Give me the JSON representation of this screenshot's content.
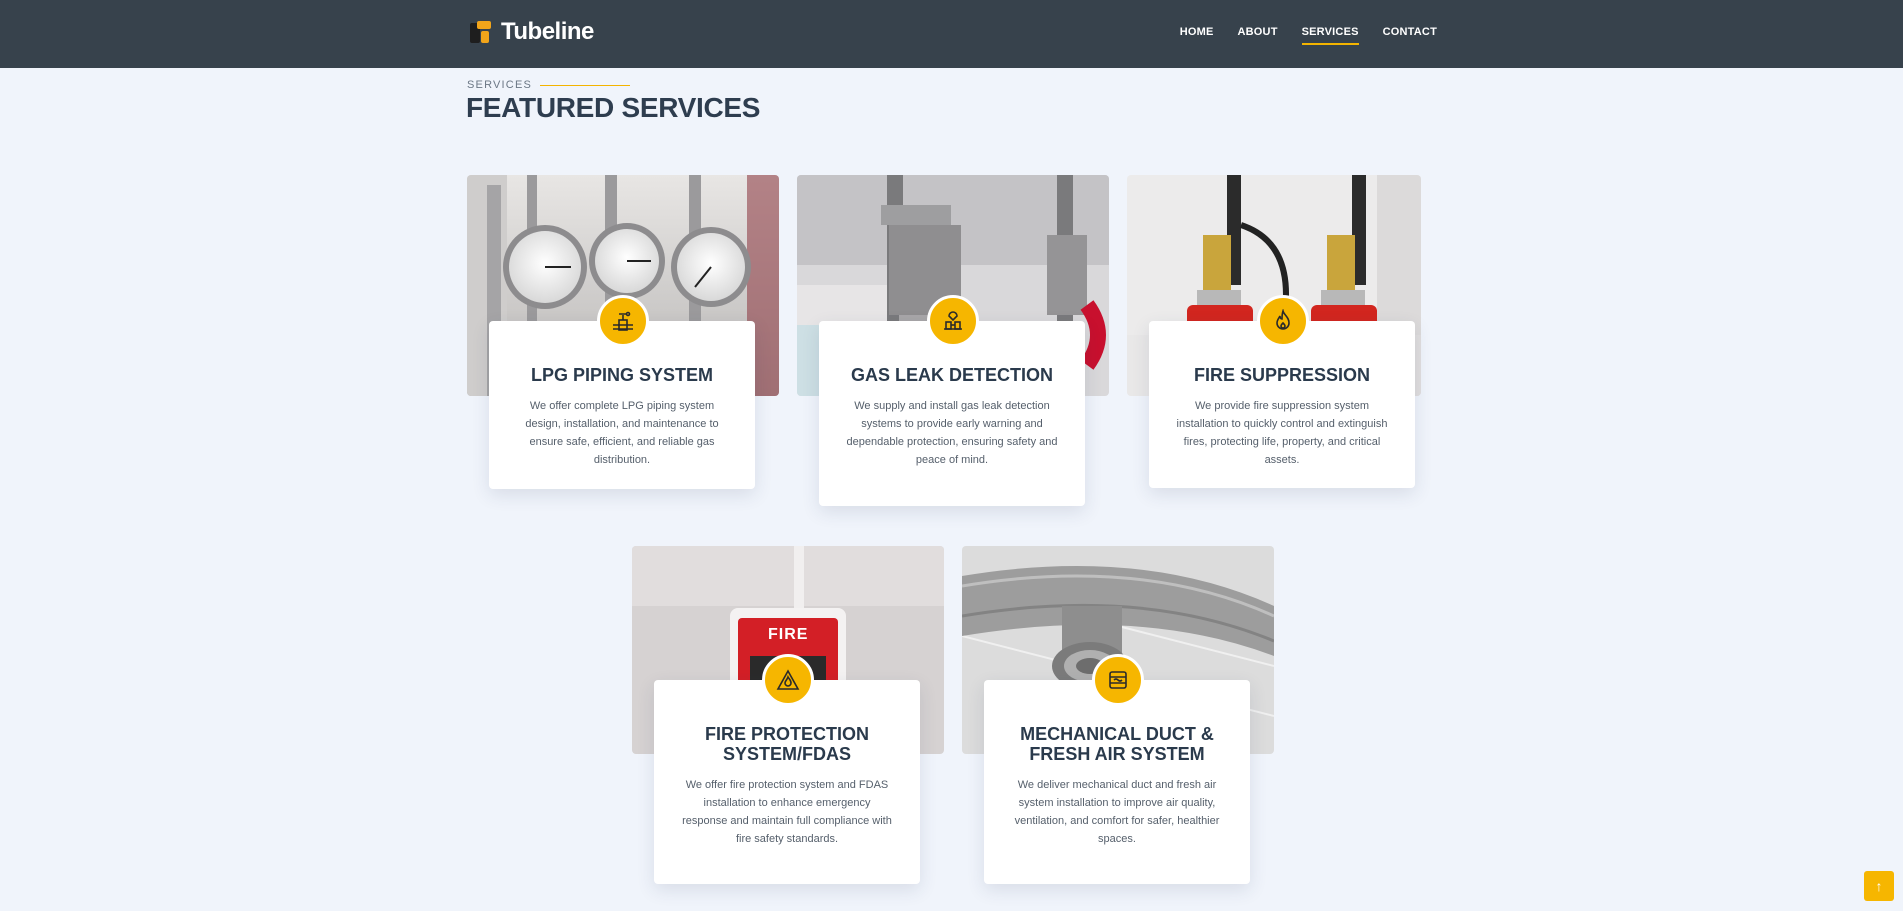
{
  "header": {
    "brand": "Tubeline",
    "nav": [
      {
        "label": "HOME",
        "active": false
      },
      {
        "label": "ABOUT",
        "active": false
      },
      {
        "label": "SERVICES",
        "active": true
      },
      {
        "label": "CONTACT",
        "active": false
      }
    ]
  },
  "section": {
    "eyebrow": "SERVICES",
    "title": "FEATURED SERVICES"
  },
  "services": [
    {
      "title": "LPG PIPING SYSTEM",
      "description": "We offer complete LPG piping system design, installation, and maintenance to ensure safe, efficient, and reliable gas distribution.",
      "icon": "pipe-valve-icon",
      "photo": "pressure-gauges-photo"
    },
    {
      "title": "GAS LEAK DETECTION",
      "description": "We supply and install gas leak detection systems to provide early warning and dependable protection, ensuring safety and peace of mind.",
      "icon": "leak-detector-icon",
      "photo": "gas-valves-photo"
    },
    {
      "title": "FIRE SUPPRESSION",
      "description": "We provide fire suppression system installation to quickly control and extinguish fires, protecting life, property, and critical assets.",
      "icon": "flame-icon",
      "photo": "suppression-cylinders-photo"
    },
    {
      "title": "FIRE PROTECTION SYSTEM/FDAS",
      "description": "We offer fire protection system and FDAS installation to enhance emergency response and maintain full compliance with fire safety standards.",
      "icon": "fire-warning-icon",
      "photo": "fire-alarm-photo",
      "photo_text": "FIRE"
    },
    {
      "title": "MECHANICAL DUCT & FRESH AIR SYSTEM",
      "description": "We deliver mechanical duct and fresh air system installation to improve air quality, ventilation, and comfort for safer, healthier spaces.",
      "icon": "air-duct-icon",
      "photo": "ceiling-duct-photo"
    }
  ],
  "scroll_top": {
    "icon": "arrow-up-icon"
  },
  "colors": {
    "header_bg": "#37424c",
    "accent": "#f6b600",
    "page_bg": "#f0f4fb"
  }
}
